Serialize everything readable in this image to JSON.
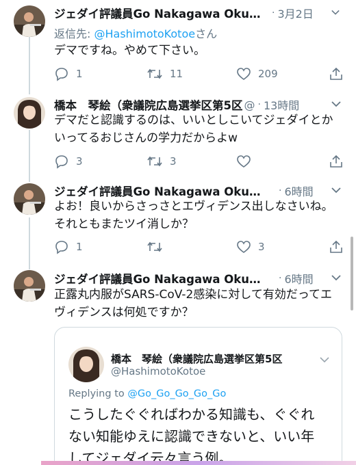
{
  "tweets": [
    {
      "author": "ジェダイ評議員Go Nakagawa Okum...",
      "handle_fragment": "",
      "time": "3月2日",
      "reply_prefix": "返信先: ",
      "reply_mention": "@HashimotoKotoe",
      "reply_suffix": "さん",
      "text": "デマですね。やめて下さい。",
      "reply_count": "1",
      "retweet_count": "11",
      "like_count": "209"
    },
    {
      "author": "橋本　琴絵（衆議院広島選挙区第5区",
      "handle_fragment": "@",
      "time": "13時間",
      "text_line1": "デマだと認識するのは、いいとしこいてジェダイとか",
      "text_line2": "いってるおじさんの学力だからよw",
      "reply_count": "3",
      "retweet_count": "3",
      "like_count": ""
    },
    {
      "author": "ジェダイ評議員Go Nakagawa Okum...",
      "handle_fragment": "",
      "time": "6時間",
      "text_line1": "よお！良いからさっさとエヴィデンス出しなさいね。",
      "text_line2": "それともまたツイ消しか？",
      "reply_count": "1",
      "retweet_count": "",
      "like_count": "3"
    },
    {
      "author": "ジェダイ評議員Go Nakagawa Okum...",
      "handle_fragment": "",
      "time": "6時間",
      "text_line1": "正露丸内服がSARS-CoV-2感染に対して有効だってエ",
      "text_line2": "ヴィデンスは何処ですか？"
    }
  ],
  "quote": {
    "author": "橋本　琴絵（衆議院広島選挙区第5区",
    "handle": "@HashimotoKotoe",
    "replying_prefix": "Replying to ",
    "replying_mention": "@Go_Go_Go_Go_Go",
    "line1": "こうしたぐぐればわかる知識も、ぐぐれ",
    "line2": "ない知能ゆえに認識できないと、いい年",
    "line3": "してジェダイ云々言う例。"
  },
  "icons": {
    "reply": "speech-bubble-icon",
    "retweet": "retweet-arrows-icon",
    "like": "heart-icon",
    "share": "share-arrow-icon",
    "more": "chevron-down-icon"
  },
  "colors": {
    "link": "#1da1f2",
    "secondary_text": "#657786",
    "divider": "#cfd9de"
  }
}
